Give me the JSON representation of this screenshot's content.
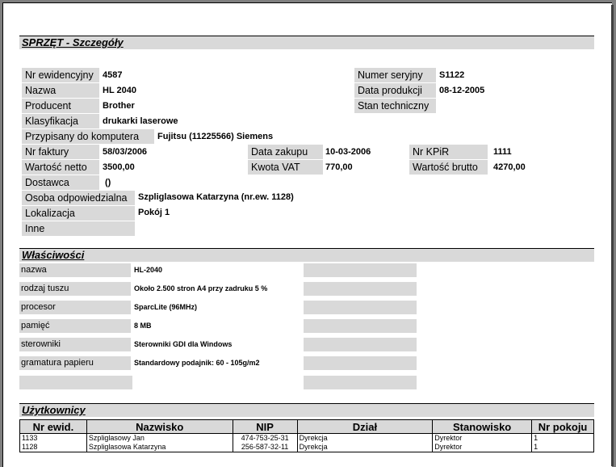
{
  "header": {
    "title": "SPRZĘT - Szczegóły"
  },
  "details": {
    "nr_ewid_label": "Nr ewidencyjny",
    "nr_ewid_value": "4587",
    "nazwa_label": "Nazwa",
    "nazwa_value": "HL 2040",
    "producent_label": "Producent",
    "producent_value": "Brother",
    "klasyfikacja_label": "Klasyfikacja",
    "klasyfikacja_value": "drukarki laserowe",
    "przypisany_label": "Przypisany do komputera",
    "przypisany_value": "Fujitsu (11225566) Siemens",
    "nr_faktury_label": "Nr faktury",
    "nr_faktury_value": "58/03/2006",
    "wartosc_netto_label": "Wartość netto",
    "wartosc_netto_value": "3500,00",
    "dostawca_label": "Dostawca",
    "dostawca_value": "()",
    "osoba_label": "Osoba odpowiedzialna",
    "osoba_value": "Szpliglasowa Katarzyna (nr.ew. 1128)",
    "lokalizacja_label": "Lokalizacja",
    "lokalizacja_value": "Pokój 1",
    "inne_label": "Inne",
    "inne_value": "",
    "numer_seryjny_label": "Numer seryjny",
    "numer_seryjny_value": "S1122",
    "data_produkcji_label": "Data produkcji",
    "data_produkcji_value": "08-12-2005",
    "stan_label": "Stan techniczny",
    "stan_value": "",
    "data_zakupu_label": "Data zakupu",
    "data_zakupu_value": "10-03-2006",
    "kwota_vat_label": "Kwota VAT",
    "kwota_vat_value": "770,00",
    "nr_kpir_label": "Nr KPiR",
    "nr_kpir_value": "1111",
    "wartosc_brutto_label": "Wartość brutto",
    "wartosc_brutto_value": "4270,00"
  },
  "properties": {
    "title": "Właściwości",
    "items": [
      {
        "label": "nazwa",
        "value": "HL-2040"
      },
      {
        "label": "rodzaj tuszu",
        "value": "Około 2.500 stron A4 przy zadruku 5 %"
      },
      {
        "label": "procesor",
        "value": "SparcLite (96MHz)"
      },
      {
        "label": "pamięć",
        "value": "8 MB"
      },
      {
        "label": "sterowniki",
        "value": "Sterowniki GDI dla Windows"
      },
      {
        "label": "gramatura papieru",
        "value": "Standardowy podajnik: 60 - 105g/m2"
      }
    ]
  },
  "users": {
    "title": "Użytkownicy",
    "columns": [
      "Nr ewid.",
      "Nazwisko",
      "NIP",
      "Dział",
      "Stanowisko",
      "Nr pokoju"
    ],
    "rows": [
      [
        "1133",
        "Szpliglasowy Jan",
        "474-753-25-31",
        "Dyrekcja",
        "Dyrektor",
        "1"
      ],
      [
        "1128",
        "Szpliglasowa Katarzyna",
        "256-587-32-11",
        "Dyrekcja",
        "Dyrektor",
        "1"
      ]
    ]
  }
}
